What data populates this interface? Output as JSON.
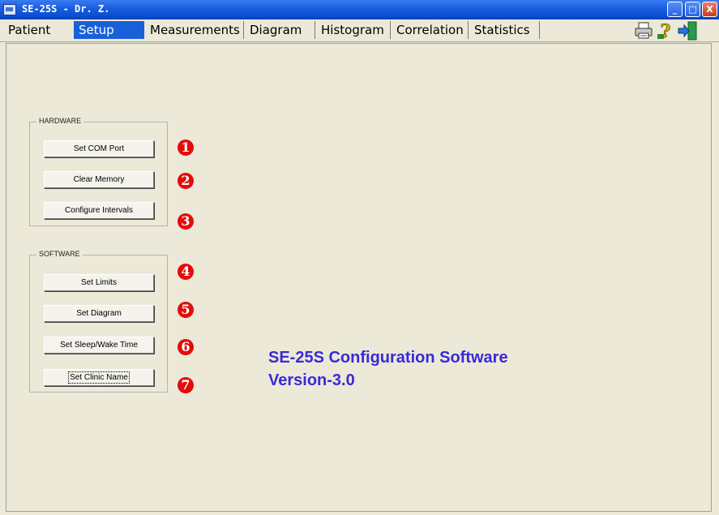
{
  "window": {
    "title": "SE-25S - Dr. Z.",
    "controls": {
      "minimize": "_",
      "maximize": "□",
      "close": "X"
    }
  },
  "tabs": [
    {
      "label": "Patient",
      "active": false
    },
    {
      "label": "Setup",
      "active": true
    },
    {
      "label": "Measurements",
      "active": false
    },
    {
      "label": "Diagram",
      "active": false
    },
    {
      "label": "Histogram",
      "active": false
    },
    {
      "label": "Correlation",
      "active": false
    },
    {
      "label": "Statistics",
      "active": false
    }
  ],
  "toolbar": {
    "icons": [
      "printer-icon",
      "help-icon",
      "exit-icon"
    ]
  },
  "hardware": {
    "label": "HARDWARE",
    "buttons": [
      {
        "label": "Set COM Port",
        "number": "1"
      },
      {
        "label": "Clear Memory",
        "number": "2"
      },
      {
        "label": "Configure Intervals",
        "number": "3"
      }
    ]
  },
  "software": {
    "label": "SOFTWARE",
    "buttons": [
      {
        "label": "Set Limits",
        "number": "4"
      },
      {
        "label": "Set Diagram",
        "number": "5"
      },
      {
        "label": "Set Sleep/Wake Time",
        "number": "6"
      },
      {
        "label": "Set Clinic Name",
        "number": "7"
      }
    ]
  },
  "caption": {
    "line1": "SE-25S Configuration Software",
    "line2": "Version-3.0"
  },
  "colors": {
    "title_bar": "#0a4dcf",
    "active_tab": "#1860d8",
    "caption_text": "#3a2ad6",
    "number_badge": "#e60b0b",
    "background": "#ece9d8"
  }
}
